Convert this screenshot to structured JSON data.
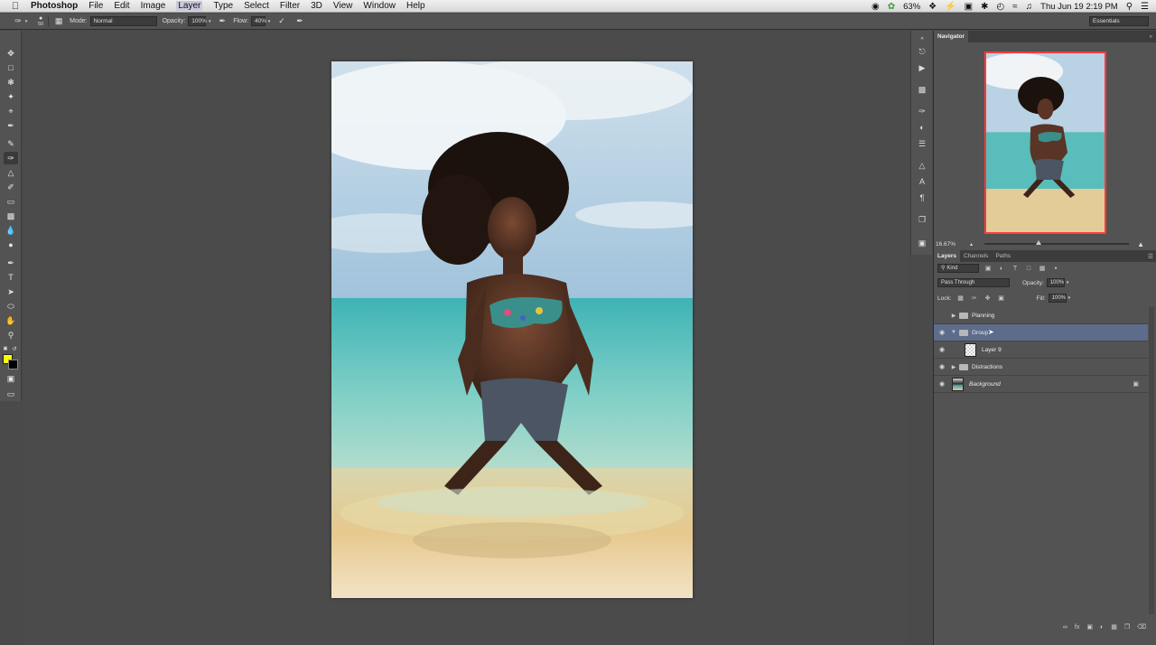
{
  "menubar": {
    "app_name": "Photoshop",
    "menus": [
      "File",
      "Edit",
      "Image",
      "Layer",
      "Type",
      "Select",
      "Filter",
      "3D",
      "View",
      "Window",
      "Help"
    ],
    "active_menu": "Layer",
    "battery": "63%",
    "clock": "Thu Jun 19  2:19 PM"
  },
  "options_bar": {
    "brush_size": "50",
    "mode_label": "Mode:",
    "mode_value": "Normal",
    "opacity_label": "Opacity:",
    "opacity_value": "100%",
    "flow_label": "Flow:",
    "flow_value": "40%",
    "workspace": "Essentials"
  },
  "colors": {
    "foreground": "#ffff00",
    "background": "#000000",
    "selected_layer": "#5e6c8c",
    "navigator_frame": "#ff3b3b"
  },
  "navigator": {
    "title": "Navigator",
    "zoom": "16.67%"
  },
  "layers_panel": {
    "tabs": [
      "Layers",
      "Channels",
      "Paths"
    ],
    "filter_kind": "Kind",
    "blend_mode": "Pass Through",
    "opacity_label": "Opacity:",
    "opacity_value": "100%",
    "lock_label": "Lock:",
    "fill_label": "Fill:",
    "fill_value": "100%",
    "layers": [
      {
        "name": "Planning",
        "type": "group",
        "visible": false,
        "expanded": false,
        "selected": false
      },
      {
        "name": "Group",
        "type": "group",
        "visible": true,
        "expanded": true,
        "selected": true
      },
      {
        "name": "Layer 9",
        "type": "layer",
        "visible": true,
        "selected": false
      },
      {
        "name": "Distractions",
        "type": "group",
        "visible": true,
        "expanded": false,
        "selected": false
      },
      {
        "name": "Background",
        "type": "background",
        "visible": true,
        "locked": true,
        "selected": false
      }
    ]
  }
}
